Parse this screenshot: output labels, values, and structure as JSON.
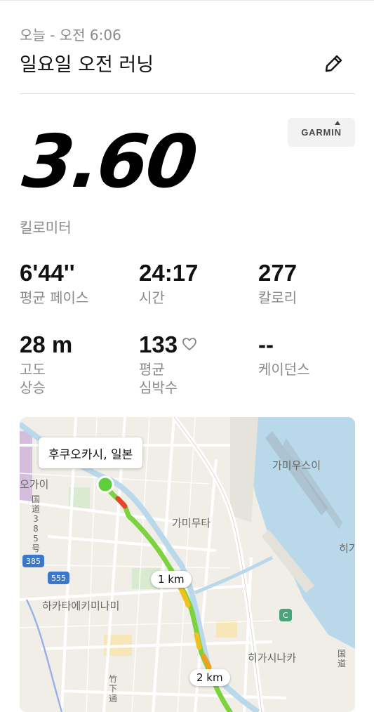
{
  "header": {
    "date_time": "오늘 - 오전 6:06",
    "title": "일요일 오전 러닝",
    "edit_icon": "pencil-icon"
  },
  "source": {
    "brand": "GARMIN"
  },
  "distance": {
    "value": "3.60",
    "unit": "킬로미터"
  },
  "stats": {
    "pace": {
      "value": "6'44''",
      "label": "평균 페이스"
    },
    "time": {
      "value": "24:17",
      "label": "시간"
    },
    "calories": {
      "value": "277",
      "label": "칼로리"
    },
    "elevation": {
      "value": "28 m",
      "label_line1": "고도",
      "label_line2": "상승"
    },
    "heart_rate": {
      "value": "133",
      "label_line1": "평균",
      "label_line2": "심박수",
      "icon": "heart-icon"
    },
    "cadence": {
      "value": "--",
      "label": "케이던스"
    }
  },
  "map": {
    "location": "후쿠오카시, 일본",
    "places": {
      "gamiusui": "가미우스이",
      "gamimuta": "가미무타",
      "hakata_ekiminami": "하카타에키미나미",
      "higashinaka": "히가시나카",
      "hakata_short": "히가",
      "okai": "오가이"
    },
    "vertical_labels": {
      "kokudo385": "国道385号",
      "kokudo_right": "国道",
      "takeshita": "竹下通"
    },
    "road_shields": {
      "r385": "385",
      "r555": "555",
      "c": "C"
    },
    "km_markers": [
      "1 km",
      "2 km"
    ],
    "colors": {
      "route_start": "#5ecf3a",
      "route_fast": "#7cd23f",
      "route_slow": "#f0c020",
      "route_hot": "#e8452a",
      "water": "#b9d9ea"
    }
  }
}
